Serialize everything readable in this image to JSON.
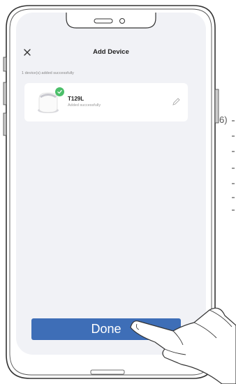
{
  "header": {
    "title": "Add Device",
    "close_icon": "close-icon"
  },
  "status": {
    "message": "1 device(s) added successfully"
  },
  "device": {
    "name": "T129L",
    "status": "Added successfully",
    "badge_icon": "check-badge-icon",
    "badge_color": "#4cbf6a",
    "edit_icon": "pencil-icon"
  },
  "footer": {
    "done_label": "Done",
    "done_color": "#3e6eb7"
  },
  "manual": {
    "step_label": "6)"
  }
}
